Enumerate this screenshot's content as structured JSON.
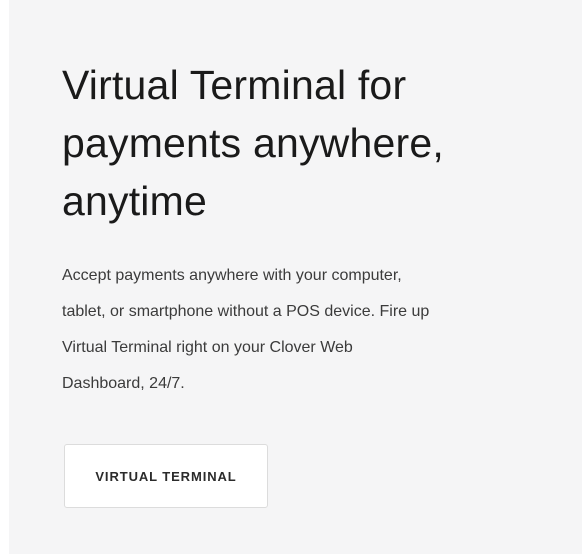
{
  "hero": {
    "headline_lines": [
      "Virtual Terminal for",
      "payments anywhere,",
      "anytime"
    ],
    "description_lines": [
      "Accept payments anywhere with your computer,",
      "tablet, or smartphone without a POS device. Fire up",
      "Virtual Terminal right on your Clover Web",
      "Dashboard, 24/7."
    ],
    "button_label": "VIRTUAL TERMINAL"
  },
  "colors": {
    "card_background": "#f5f5f6",
    "heading_text": "#1a1a1a",
    "body_text": "#3b3b3b",
    "button_border": "#dcdcdc"
  }
}
